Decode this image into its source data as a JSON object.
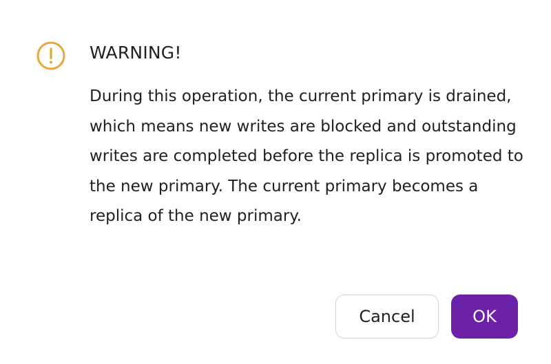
{
  "dialog": {
    "icon": "exclamation-circle-icon",
    "accent_color": "#eaa63a",
    "title": "WARNING!",
    "message": "During this operation, the current primary is drained, which means new writes are blocked and outstanding writes are completed before the replica is promoted to the new primary. The current primary becomes a replica of the new primary.",
    "buttons": {
      "cancel_label": "Cancel",
      "ok_label": "OK",
      "ok_color": "#6b21a8"
    }
  }
}
